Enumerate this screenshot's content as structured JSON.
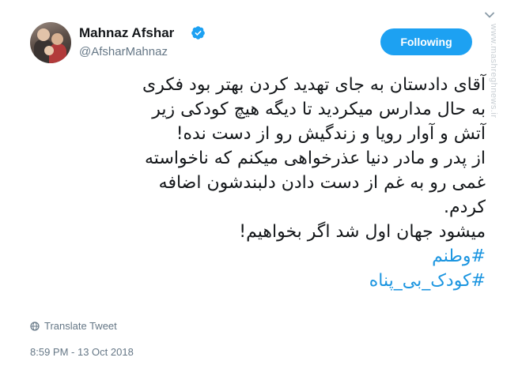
{
  "author": {
    "name": "Mahnaz Afshar",
    "handle": "@AfsharMahnaz",
    "verified": true,
    "avatar_icon": "profile-photo"
  },
  "follow_button": {
    "label": "Following"
  },
  "watermark": "www.mashreghnews.ir",
  "tweet": {
    "lines": [
      "آقای دادستان به جای تهدید کردن بهتر بود فکری",
      "به حال مدارس میکردید تا دیگه هیچ کودکی زیر",
      "آتش و آوار رویا و زندگیش رو از دست نده!",
      "از پدر و مادر دنیا عذرخواهی میکنم که ناخواسته",
      "غمی رو به غم از دست دادن دلبندشون اضافه",
      "کردم.",
      "میشود جهان اول شد اگر بخواهیم!"
    ],
    "hashtags": [
      "#وطنم",
      "#کودک_بی_پناه"
    ]
  },
  "translate_label": "Translate Tweet",
  "timestamp": "8:59 PM - 13 Oct 2018",
  "colors": {
    "accent": "#1da1f2",
    "hashtag": "#1b95e0",
    "muted": "#657786",
    "text": "#14171a"
  }
}
